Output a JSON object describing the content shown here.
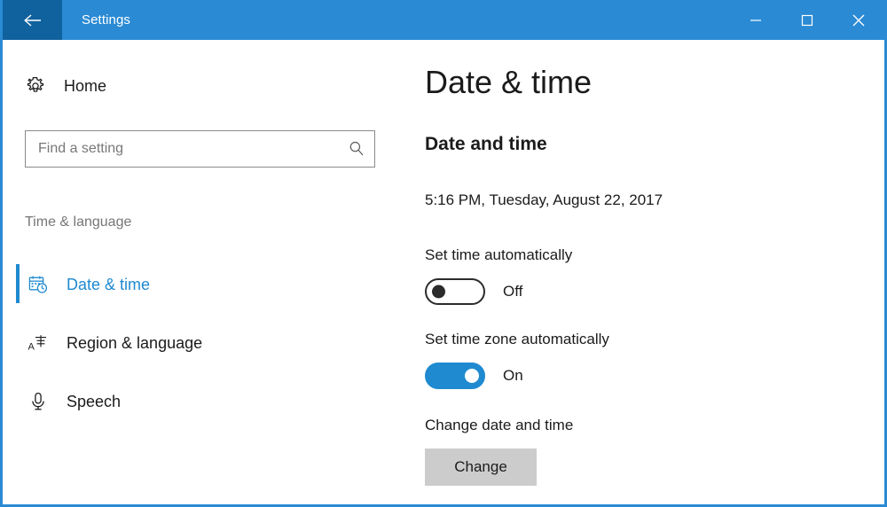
{
  "window": {
    "title": "Settings",
    "accent_color": "#2a8ad4",
    "back_accent_color": "#10629f",
    "controls": {
      "back": "Back",
      "minimize": "Minimize",
      "maximize": "Maximize",
      "close": "Close"
    }
  },
  "sidebar": {
    "home": {
      "label": "Home",
      "icon": "gear-icon"
    },
    "search": {
      "value": "",
      "placeholder": "Find a setting",
      "icon": "search-icon"
    },
    "section_title": "Time & language",
    "items": [
      {
        "label": "Date & time",
        "icon": "calendar-clock-icon",
        "selected": true
      },
      {
        "label": "Region & language",
        "icon": "language-icon",
        "selected": false
      },
      {
        "label": "Speech",
        "icon": "microphone-icon",
        "selected": false
      }
    ]
  },
  "content": {
    "page_title": "Date & time",
    "section_heading": "Date and time",
    "current_datetime": "5:16 PM, Tuesday, August 22, 2017",
    "settings": [
      {
        "label": "Set time automatically",
        "state": "Off",
        "on": false
      },
      {
        "label": "Set time zone automatically",
        "state": "On",
        "on": true
      }
    ],
    "change_section": {
      "label": "Change date and time",
      "button_label": "Change"
    }
  },
  "colors": {
    "accent": "#1f8ad0",
    "title_bar": "#2a8ad4",
    "button_face": "#cccccc",
    "muted_text": "#767676"
  }
}
